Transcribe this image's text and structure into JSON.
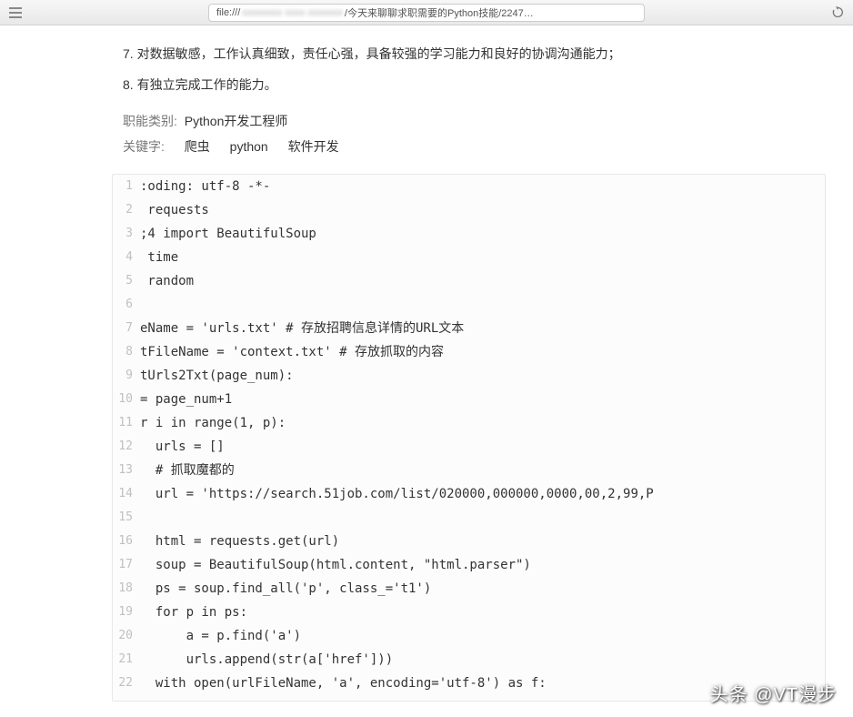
{
  "browser": {
    "url_prefix": "file:///",
    "url_blurred": "xxxxxxxx xxxx xxxxxxx",
    "url_suffix": "/今天来聊聊求职需要的Python技能/2247…"
  },
  "requirements": {
    "line7": "7. 对数据敏感，工作认真细致，责任心强，具备较强的学习能力和良好的协调沟通能力；",
    "line8": "8. 有独立完成工作的能力。"
  },
  "meta": {
    "category_label": "职能类别:",
    "category_value": "Python开发工程师",
    "keywords_label": "关键字:",
    "keywords": [
      "爬虫",
      "python",
      "软件开发"
    ]
  },
  "code": {
    "lines": [
      ":oding: utf-8 -*-",
      " requests",
      ";4 import BeautifulSoup",
      " time",
      " random",
      "",
      "eName = 'urls.txt' # 存放招聘信息详情的URL文本",
      "tFileName = 'context.txt' # 存放抓取的内容",
      "tUrls2Txt(page_num):",
      "= page_num+1",
      "r i in range(1, p):",
      "  urls = []",
      "  # 抓取魔都的",
      "  url = 'https://search.51job.com/list/020000,000000,0000,00,2,99,P",
      "",
      "  html = requests.get(url)",
      "  soup = BeautifulSoup(html.content, \"html.parser\")",
      "  ps = soup.find_all('p', class_='t1')",
      "  for p in ps:",
      "      a = p.find('a')",
      "      urls.append(str(a['href']))",
      "  with open(urlFileName, 'a', encoding='utf-8') as f:"
    ]
  },
  "watermark": "头条 @VT漫步"
}
